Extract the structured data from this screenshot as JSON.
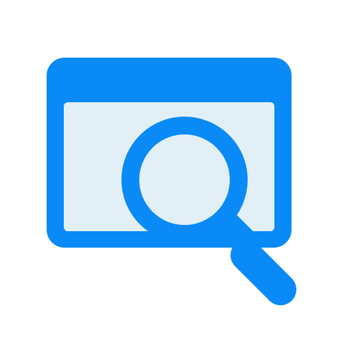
{
  "icon": {
    "name": "browser-search-icon",
    "colors": {
      "frame": "#0A8AF6",
      "screen": "#E3EFF7",
      "background": "#FFFFFF"
    }
  }
}
